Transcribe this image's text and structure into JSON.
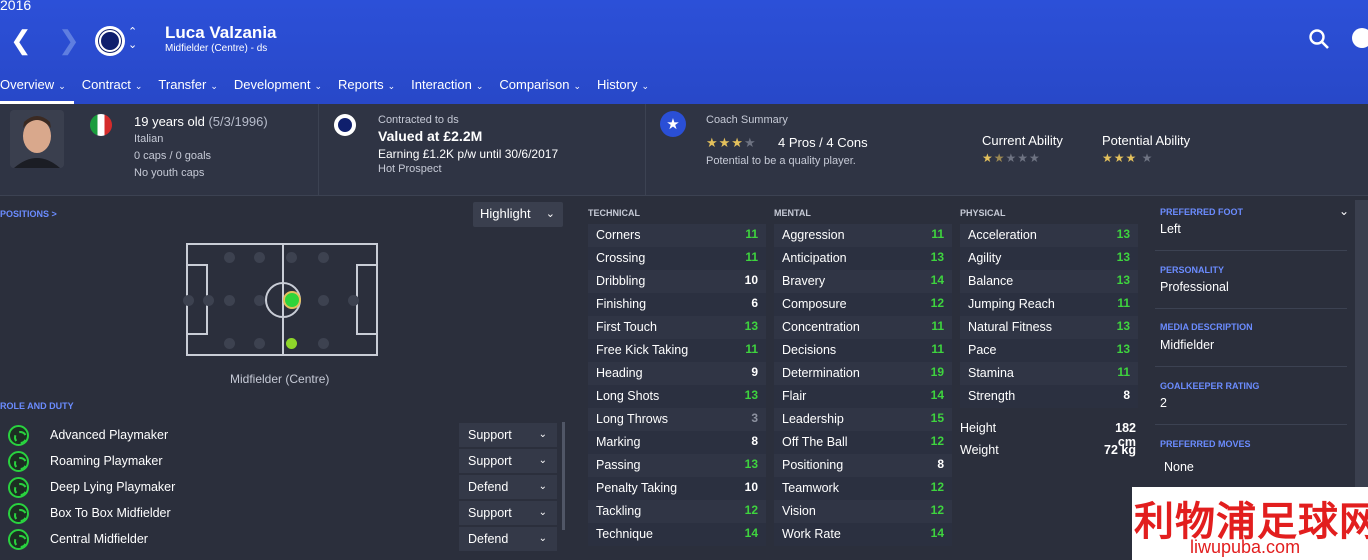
{
  "header": {
    "year": "2016",
    "player_name": "Luca Valzania",
    "player_subtitle": "Midfielder (Centre) - ds"
  },
  "tabs": [
    {
      "label": "Overview"
    },
    {
      "label": "Contract"
    },
    {
      "label": "Transfer"
    },
    {
      "label": "Development"
    },
    {
      "label": "Reports"
    },
    {
      "label": "Interaction"
    },
    {
      "label": "Comparison"
    },
    {
      "label": "History"
    }
  ],
  "bio": {
    "age": "19 years old",
    "dob": "(5/3/1996)",
    "nationality": "Italian",
    "caps": "0 caps / 0 goals",
    "youth_caps": "No youth caps"
  },
  "contract": {
    "contracted_to": "Contracted to ds",
    "valued": "Valued at £2.2M",
    "earning": "Earning £1.2K p/w until 30/6/2017",
    "status": "Hot Prospect"
  },
  "coach": {
    "title": "Coach Summary",
    "stars": 3,
    "pros_cons": "4 Pros / 4 Cons",
    "potential_note": "Potential to be a quality player.",
    "current_ability_label": "Current Ability",
    "current_ability_stars": 1.5,
    "potential_ability_label": "Potential Ability",
    "potential_ability_stars": 3
  },
  "positions": {
    "label": "POSITIONS >",
    "highlight_label": "Highlight",
    "position_name": "Midfielder (Centre)"
  },
  "roles": {
    "label": "ROLE AND DUTY",
    "items": [
      {
        "name": "Advanced Playmaker",
        "duty": "Support"
      },
      {
        "name": "Roaming Playmaker",
        "duty": "Support"
      },
      {
        "name": "Deep Lying Playmaker",
        "duty": "Defend"
      },
      {
        "name": "Box To Box Midfielder",
        "duty": "Support"
      },
      {
        "name": "Central Midfielder",
        "duty": "Defend"
      }
    ]
  },
  "attributes": {
    "technical_label": "TECHNICAL",
    "mental_label": "MENTAL",
    "physical_label": "PHYSICAL",
    "technical": [
      {
        "name": "Corners",
        "value": "11"
      },
      {
        "name": "Crossing",
        "value": "11"
      },
      {
        "name": "Dribbling",
        "value": "10"
      },
      {
        "name": "Finishing",
        "value": "6"
      },
      {
        "name": "First Touch",
        "value": "13"
      },
      {
        "name": "Free Kick Taking",
        "value": "11"
      },
      {
        "name": "Heading",
        "value": "9"
      },
      {
        "name": "Long Shots",
        "value": "13"
      },
      {
        "name": "Long Throws",
        "value": "3"
      },
      {
        "name": "Marking",
        "value": "8"
      },
      {
        "name": "Passing",
        "value": "13"
      },
      {
        "name": "Penalty Taking",
        "value": "10"
      },
      {
        "name": "Tackling",
        "value": "12"
      },
      {
        "name": "Technique",
        "value": "14"
      }
    ],
    "mental": [
      {
        "name": "Aggression",
        "value": "11"
      },
      {
        "name": "Anticipation",
        "value": "13"
      },
      {
        "name": "Bravery",
        "value": "14"
      },
      {
        "name": "Composure",
        "value": "12"
      },
      {
        "name": "Concentration",
        "value": "11"
      },
      {
        "name": "Decisions",
        "value": "11"
      },
      {
        "name": "Determination",
        "value": "19"
      },
      {
        "name": "Flair",
        "value": "14"
      },
      {
        "name": "Leadership",
        "value": "15"
      },
      {
        "name": "Off The Ball",
        "value": "12"
      },
      {
        "name": "Positioning",
        "value": "8"
      },
      {
        "name": "Teamwork",
        "value": "12"
      },
      {
        "name": "Vision",
        "value": "12"
      },
      {
        "name": "Work Rate",
        "value": "14"
      }
    ],
    "physical": [
      {
        "name": "Acceleration",
        "value": "13"
      },
      {
        "name": "Agility",
        "value": "13"
      },
      {
        "name": "Balance",
        "value": "13"
      },
      {
        "name": "Jumping Reach",
        "value": "11"
      },
      {
        "name": "Natural Fitness",
        "value": "13"
      },
      {
        "name": "Pace",
        "value": "13"
      },
      {
        "name": "Stamina",
        "value": "11"
      },
      {
        "name": "Strength",
        "value": "8"
      }
    ],
    "height_label": "Height",
    "height": "182 cm",
    "weight_label": "Weight",
    "weight": "72 kg"
  },
  "side": {
    "preferred_foot_label": "PREFERRED FOOT",
    "preferred_foot": "Left",
    "personality_label": "PERSONALITY",
    "personality": "Professional",
    "media_label": "MEDIA DESCRIPTION",
    "media": "Midfielder",
    "gk_label": "GOALKEEPER RATING",
    "gk": "2",
    "moves_label": "PREFERRED MOVES",
    "moves": "None"
  },
  "watermark": {
    "chinese": "利物浦足球网",
    "site": "liwupuba.com"
  },
  "colors": {
    "header_blue": "#2a4fd6",
    "green_value": "#3ed43e",
    "white_value": "#ffffff",
    "grey_value": "#8d92a0",
    "star_gold": "#e3c05c"
  }
}
